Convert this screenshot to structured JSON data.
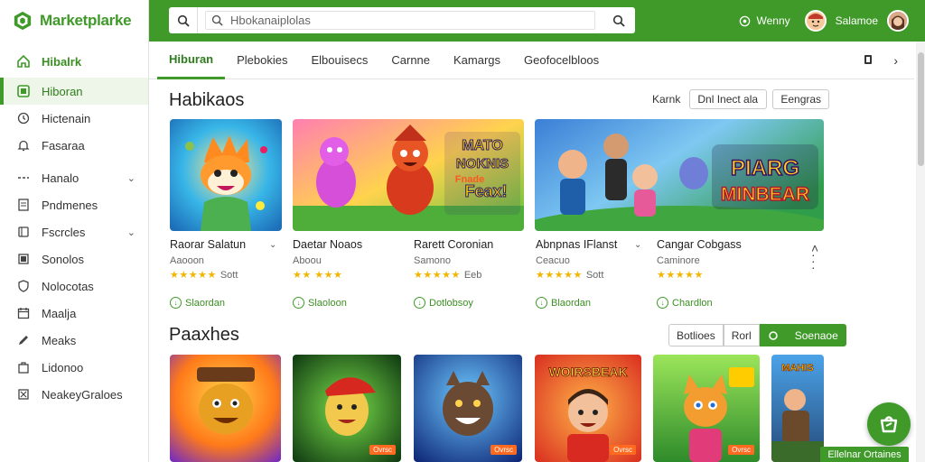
{
  "app": {
    "name": "Marketplarke"
  },
  "sidebar": {
    "items": [
      {
        "label": "Hibalrk",
        "icon": "home-icon"
      },
      {
        "label": "Hiboran",
        "icon": "grid-icon"
      },
      {
        "label": "Hictenain",
        "icon": "clock-icon"
      },
      {
        "label": "Fasaraa",
        "icon": "bell-icon"
      },
      {
        "label": "Hanalo",
        "icon": "category-icon"
      },
      {
        "label": "Pndmenes",
        "icon": "document-icon"
      },
      {
        "label": "Fscrcles",
        "icon": "tag-icon"
      },
      {
        "label": "Sonolos",
        "icon": "folder-icon"
      },
      {
        "label": "Nolocotas",
        "icon": "shield-icon"
      },
      {
        "label": "Maalja",
        "icon": "calendar-icon"
      },
      {
        "label": "Meaks",
        "icon": "pen-icon"
      },
      {
        "label": "Lidonoo",
        "icon": "bag-icon"
      },
      {
        "label": "NeakeyGraloes",
        "icon": "puzzle-icon"
      }
    ]
  },
  "header": {
    "search_placeholder": "Hbokanaiplolas",
    "user1_label": "Wenny",
    "user2_label": "Salamoe"
  },
  "tabs": [
    "Hiburan",
    "Plebokies",
    "Elbouisecs",
    "Carnne",
    "Kamargs",
    "Geofocelbloos"
  ],
  "section1": {
    "title": "Habikaos",
    "filter_label": "Karnk",
    "filter_select": "Dnl Inect ala",
    "filter_button": "Eengras",
    "cards": [
      {
        "title": "Raorar Salatun",
        "sub": "Aaooon",
        "rating": "Sott",
        "action": "Slaordan"
      },
      {
        "title": "Daetar Noaos",
        "sub": "Aboou",
        "rating": "",
        "action": "Slaoloon"
      },
      {
        "title": "Rarett Coronian",
        "sub": "Samono",
        "rating": "Eeb",
        "action": "Dotlobsoy"
      },
      {
        "title": "Abnpnas IFlanst",
        "sub": "Ceacuo",
        "rating": "Sott",
        "action": "Blaordan"
      },
      {
        "title": "Cangar Cobgass",
        "sub": "Caminore",
        "rating": "",
        "action": "Chardlon"
      }
    ],
    "art": [
      {
        "headline": "",
        "tag": ""
      },
      {
        "headline": "MATO\nNOKNIS\nFnade\nFeax!",
        "tag": ""
      },
      {
        "headline": "PIARG\nMINBEAR",
        "tag": ""
      }
    ]
  },
  "section2": {
    "title": "Paaxhes",
    "buttons": [
      "Botlioes",
      "Rorl",
      "",
      "Soenaoe"
    ],
    "tiles": [
      {
        "art": "",
        "tag": ""
      },
      {
        "art": "",
        "tag": "Ovrsc"
      },
      {
        "art": "",
        "tag": "Ovrsc"
      },
      {
        "art": "WOIRSBEAK",
        "tag": "Ovrsc"
      },
      {
        "art": "",
        "tag": "Ovrsc"
      },
      {
        "art": "MAHIS",
        "tag": ""
      }
    ]
  },
  "fab": {
    "label": "Ellelnar Ortaines"
  },
  "colors": {
    "brand": "#3f9a29",
    "star": "#f2b500",
    "badge": "#ff6a20"
  }
}
